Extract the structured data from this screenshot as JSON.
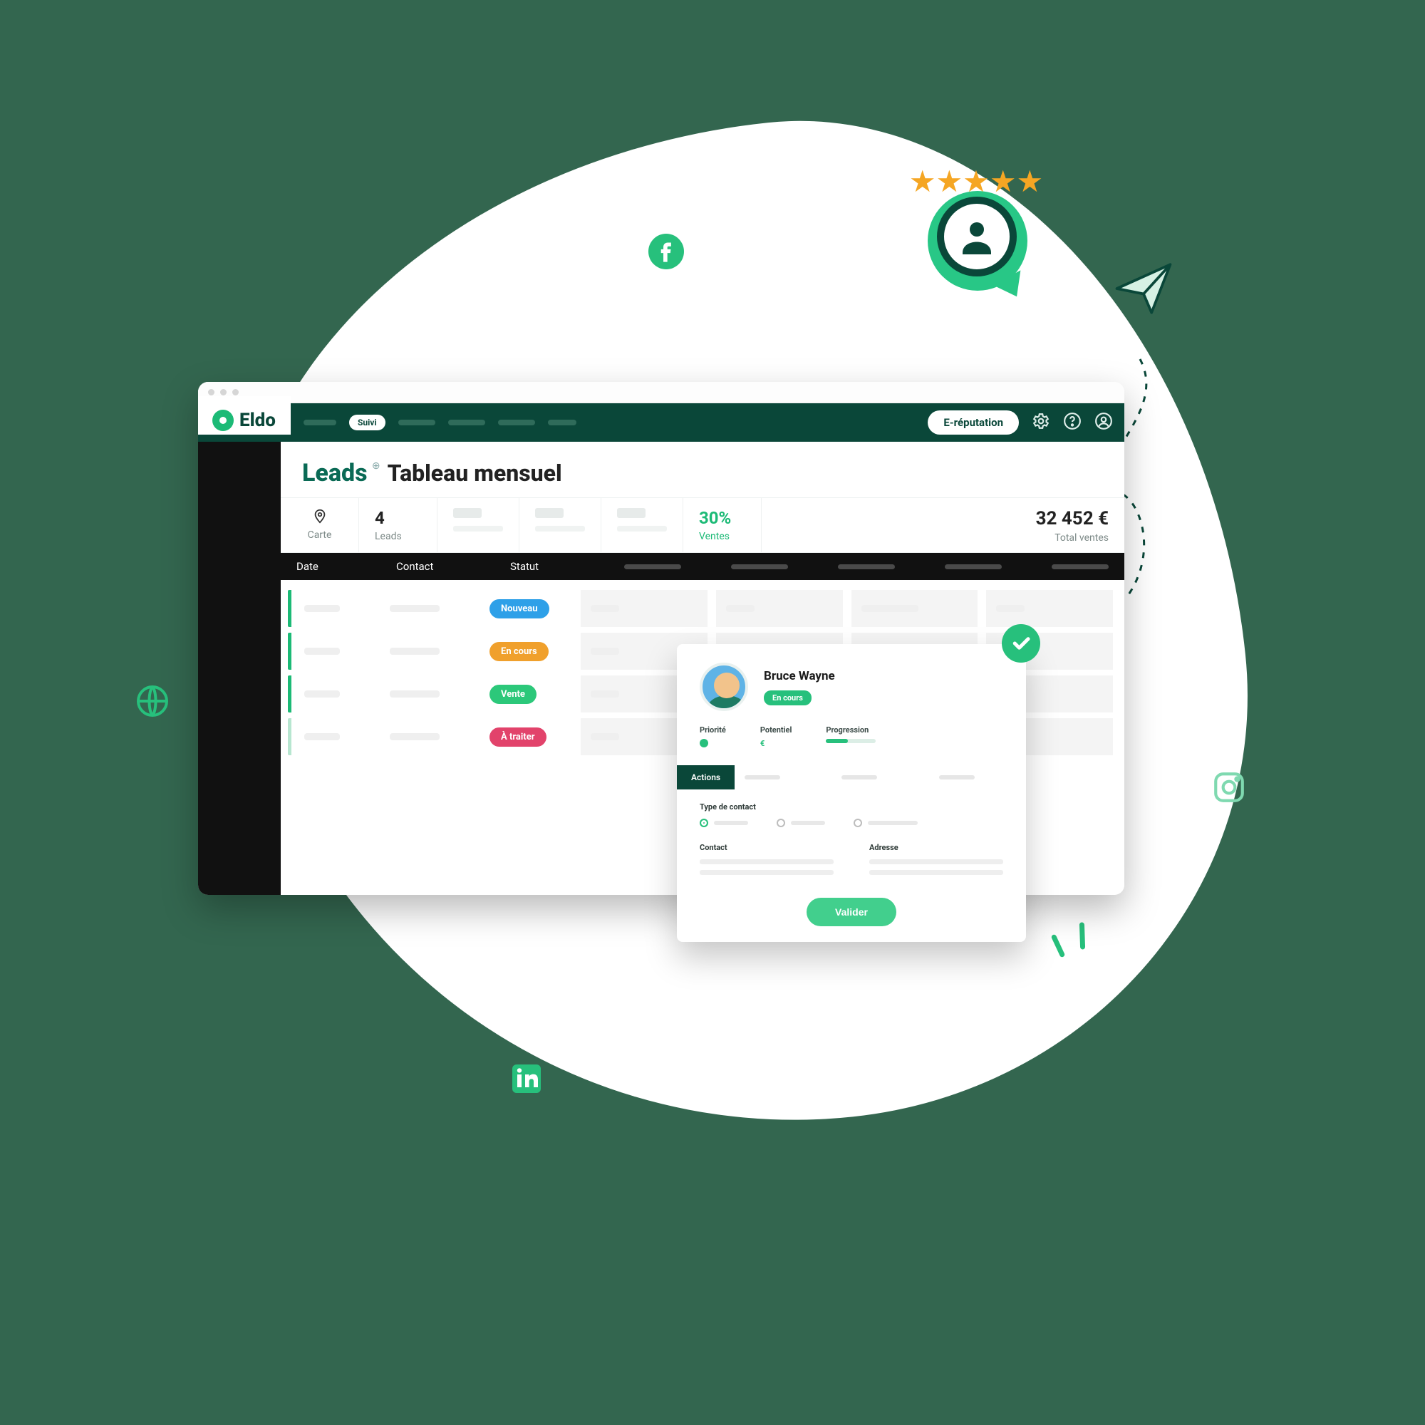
{
  "brand": "Eldo",
  "topnav": {
    "active_pill": "Suivi",
    "ereputation": "E-réputation"
  },
  "page": {
    "title": "Leads",
    "subtitle": "Tableau mensuel"
  },
  "kpis": {
    "map_label": "Carte",
    "leads_value": "4",
    "leads_label": "Leads",
    "sales_pct": "30%",
    "sales_label": "Ventes",
    "total_value": "32 452 €",
    "total_label": "Total ventes"
  },
  "table": {
    "col_date": "Date",
    "col_contact": "Contact",
    "col_status": "Statut"
  },
  "statuses": {
    "new": "Nouveau",
    "in_progress": "En cours",
    "sale": "Vente",
    "to_process": "À traiter"
  },
  "lead_card": {
    "name": "Bruce Wayne",
    "status": "En cours",
    "priority_label": "Priorité",
    "potential_label": "Potentiel",
    "potential_symbol": "€",
    "progress_label": "Progression",
    "tab_actions": "Actions",
    "contact_type_label": "Type de contact",
    "contact_label": "Contact",
    "address_label": "Adresse",
    "validate": "Valider"
  }
}
